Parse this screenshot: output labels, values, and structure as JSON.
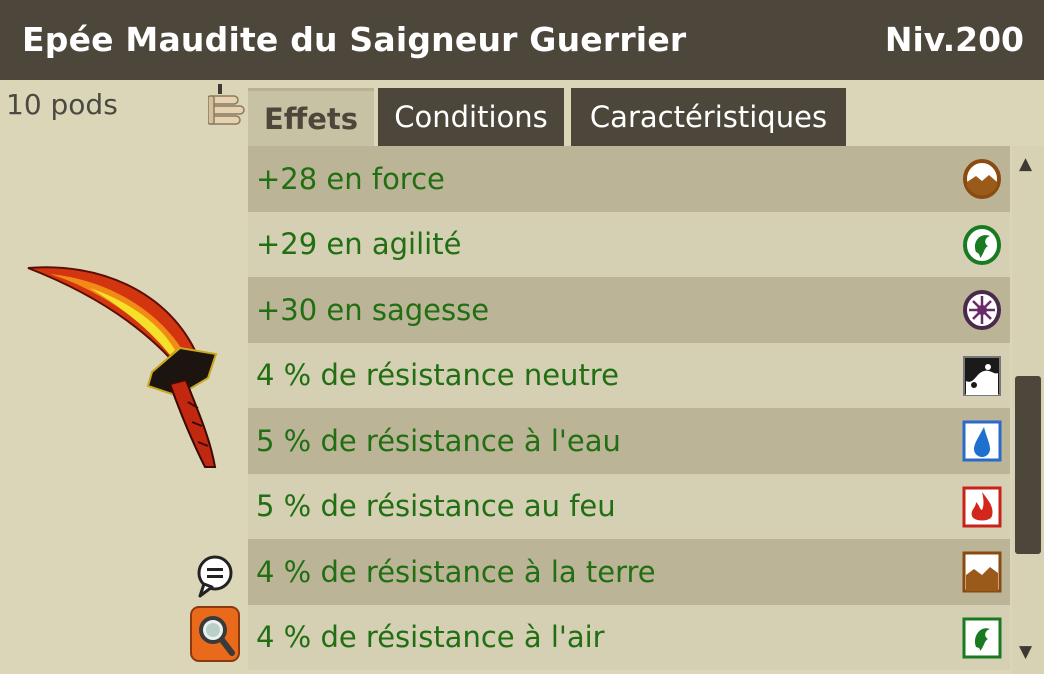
{
  "header": {
    "title": "Epée Maudite du Saigneur Guerrier",
    "level": "Niv.200"
  },
  "item": {
    "weight": "10 pods"
  },
  "tabs": [
    {
      "label": "Effets",
      "active": true
    },
    {
      "label": "Conditions",
      "active": false
    },
    {
      "label": "Caractéristiques",
      "active": false
    }
  ],
  "effects": [
    {
      "text": "+28 en force",
      "icon": "strength-icon"
    },
    {
      "text": "+29 en agilité",
      "icon": "agility-icon"
    },
    {
      "text": "+30 en sagesse",
      "icon": "wisdom-icon"
    },
    {
      "text": "4 % de résistance neutre",
      "icon": "neutral-resistance-icon"
    },
    {
      "text": "5 % de résistance à l'eau",
      "icon": "water-resistance-icon"
    },
    {
      "text": "5 % de résistance au feu",
      "icon": "fire-resistance-icon"
    },
    {
      "text": "4 % de résistance à la terre",
      "icon": "earth-resistance-icon"
    },
    {
      "text": "4 % de résistance à l'air",
      "icon": "air-resistance-icon"
    }
  ],
  "colors": {
    "header_bg": "#4d463a",
    "effect_text": "#216f12",
    "row_dark": "#bcb496",
    "row_light": "#d5cfb3"
  }
}
